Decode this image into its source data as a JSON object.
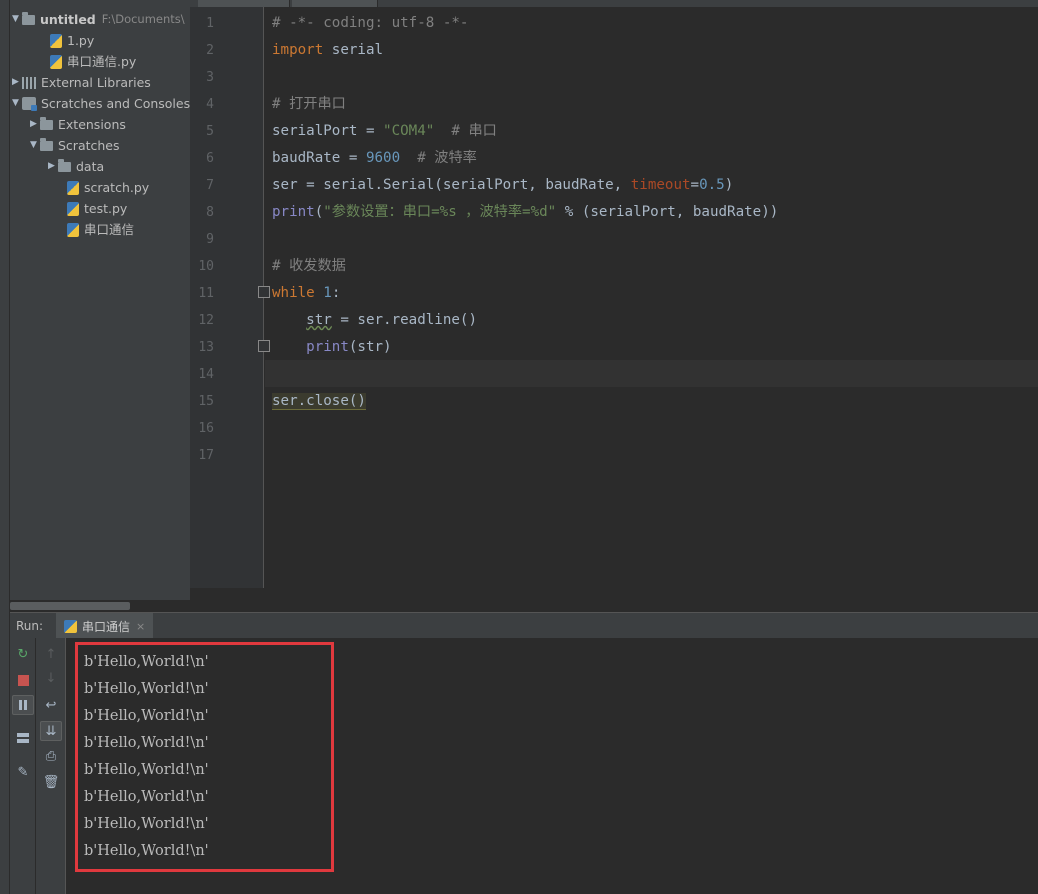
{
  "project": {
    "root_name": "untitled",
    "root_path": "F:\\Documents\\",
    "items": [
      {
        "label": "1.py"
      },
      {
        "label": "串口通信.py"
      },
      {
        "label": "External Libraries"
      },
      {
        "label": "Scratches and Consoles"
      },
      {
        "label": "Extensions"
      },
      {
        "label": "Scratches"
      },
      {
        "label": "data"
      },
      {
        "label": "scratch.py"
      },
      {
        "label": "test.py"
      },
      {
        "label": "串口通信"
      }
    ]
  },
  "editor": {
    "line_numbers": [
      "1",
      "2",
      "3",
      "4",
      "5",
      "6",
      "7",
      "8",
      "9",
      "10",
      "11",
      "12",
      "13",
      "14",
      "15",
      "16",
      "17"
    ],
    "l1": "# -*- coding: utf-8 -*-",
    "l2_kw": "import",
    "l2_rest": " serial",
    "l4": "# 打开串口",
    "l5_a": "serialPort = ",
    "l5_str": "\"COM4\"",
    "l5_cmt": "  # 串口",
    "l6_a": "baudRate = ",
    "l6_num": "9600",
    "l6_cmt": "  # 波特率",
    "l7_a": "ser = serial.Serial(serialPort, baudRate, ",
    "l7_param": "timeout",
    "l7_eq": "=",
    "l7_num": "0.5",
    "l7_end": ")",
    "l8_fn": "print",
    "l8_open": "(",
    "l8_str": "\"参数设置：串口=%s ，波特率=%d\"",
    "l8_rest": " % (serialPort, baudRate))",
    "l10": "# 收发数据",
    "l11_kw": "while",
    "l11_sp": " ",
    "l11_num": "1",
    "l11_colon": ":",
    "l12_indent": "    ",
    "l12_var": "str",
    "l12_rest": " = ser.readline()",
    "l13_indent": "    ",
    "l13_fn": "print",
    "l13_rest": "(str)",
    "l15": "ser.close()"
  },
  "run": {
    "label": "Run:",
    "tab_label": "串口通信",
    "close_glyph": "×",
    "output": [
      "b'Hello,World!\\n'",
      "b'Hello,World!\\n'",
      "b'Hello,World!\\n'",
      "b'Hello,World!\\n'",
      "b'Hello,World!\\n'",
      "b'Hello,World!\\n'",
      "b'Hello,World!\\n'",
      "b'Hello,World!\\n'"
    ]
  },
  "colors": {
    "highlight_box": "#e0393e",
    "keyword": "#cc7832",
    "string": "#6a8759",
    "number": "#6897bb",
    "comment": "#808080"
  }
}
